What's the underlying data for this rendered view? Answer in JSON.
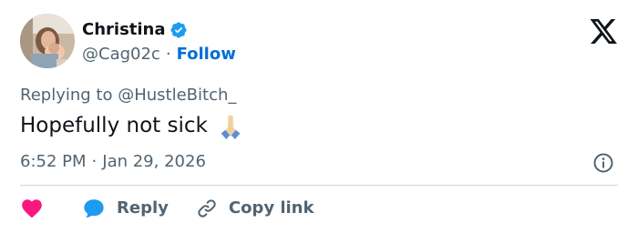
{
  "author": {
    "display_name": "Christina",
    "handle": "@Cag02c",
    "separator": "·",
    "follow_label": "Follow"
  },
  "reply": {
    "prefix": "Replying to",
    "handle": "@HustleBitch_"
  },
  "tweet": {
    "text": "Hopefully not sick",
    "emoji": "folded-hands-emoji"
  },
  "meta": {
    "time": "6:52 PM",
    "separator": "·",
    "date": "Jan 29, 2026"
  },
  "actions": {
    "reply_label": "Reply",
    "copy_link_label": "Copy link"
  },
  "icons": {
    "verified": "verified-badge-icon",
    "brand": "x-logo-icon",
    "info": "info-icon",
    "like": "heart-icon",
    "reply": "speech-bubble-icon",
    "copy": "link-icon"
  },
  "colors": {
    "primary_text": "#0f1419",
    "secondary_text": "#536471",
    "accent_blue": "#006fd6",
    "verified_blue": "#1d9bf0",
    "heart_pink": "#f91880",
    "divider": "#cfd9de"
  }
}
